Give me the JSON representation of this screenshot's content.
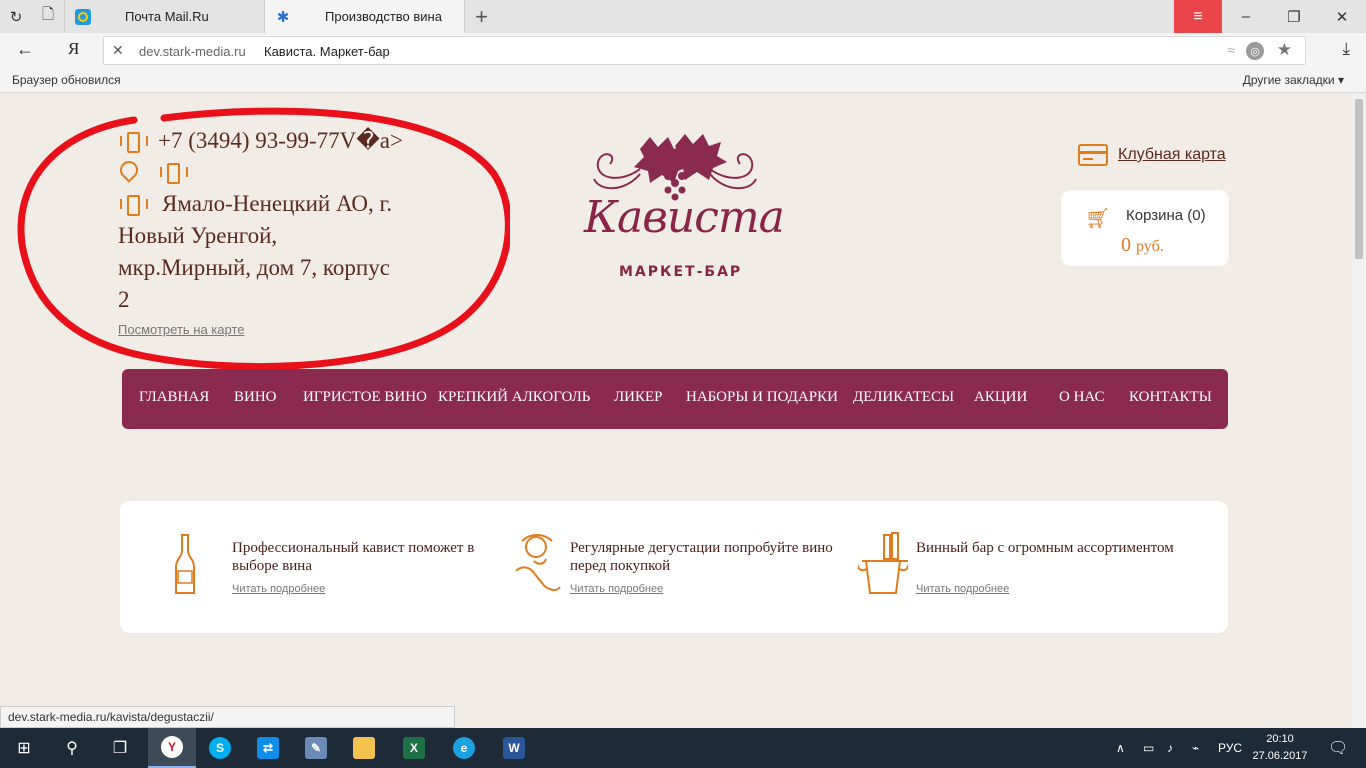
{
  "browser": {
    "tabs": [
      {
        "label": "Почта Mail.Ru"
      },
      {
        "label": "Производство вина"
      }
    ],
    "url_domain": "dev.stark-media.ru",
    "url_title": "Кависта. Маркет-бар",
    "search_letter": "Я",
    "bookmarks_left": "Браузер обновился",
    "bookmarks_right": "Другие закладки ▾",
    "status_url": "dev.stark-media.ru/kavista/degustaczii/"
  },
  "header": {
    "phone": "+7 (3494) 93-99-77V�a>",
    "address_line1": "Ямало-Ненецкий АО, г.",
    "address_line2": "Новый Уренгой,",
    "address_line3": "мкр.Мирный, дом 7, корпус",
    "address_line4": "2",
    "map_link": "Посмотреть на карте",
    "logo_title": "Кависта",
    "logo_subtitle": "МАРКЕТ-БАР",
    "club_card": "Клубная карта",
    "cart_label": "Корзина (0)",
    "cart_sum": "0",
    "cart_currency": "руб."
  },
  "menu": [
    "ГЛАВНАЯ",
    "ВИНО",
    "ИГРИСТОЕ ВИНО",
    "КРЕПКИЙ АЛКОГОЛЬ",
    "ЛИКЕР",
    "НАБОРЫ И ПОДАРКИ",
    "ДЕЛИКАТЕСЫ",
    "АКЦИИ",
    "О НАС",
    "КОНТАКТЫ"
  ],
  "features": [
    {
      "text": "Профессиональный кавист поможет в выборе вина",
      "link": "Читать подробнее",
      "icon": "wine-bottle-icon"
    },
    {
      "text": "Регулярные дегустации попробуйте вино перед покупкой",
      "link": "Читать подробнее",
      "icon": "tasting-icon"
    },
    {
      "text": "Винный бар с огромным ассортиментом",
      "link": "Читать подробнее",
      "icon": "ice-bucket-icon"
    }
  ],
  "taskbar": {
    "language": "РУС",
    "time": "20:10",
    "date": "27.06.2017"
  },
  "colors": {
    "accent": "#e07b1e",
    "brand": "#8b2a4f",
    "page_bg": "#f2ece6",
    "annotation": "#e8101a"
  }
}
